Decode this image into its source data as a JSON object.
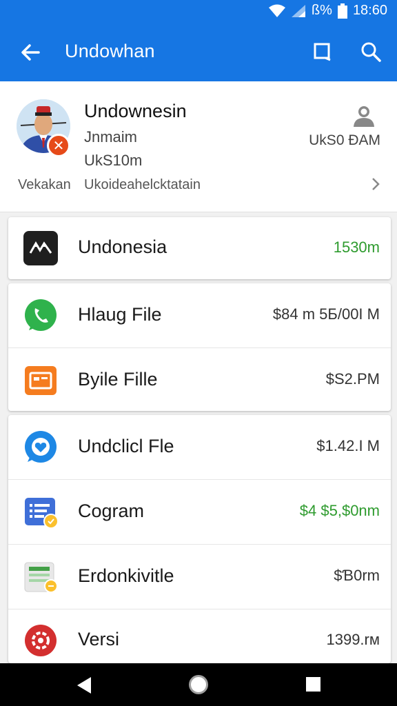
{
  "status_bar": {
    "battery_text": "ß%",
    "time": "18:60"
  },
  "app_bar": {
    "title": "Undowhan",
    "icons": [
      "back-arrow-icon",
      "crop-square-icon",
      "search-icon"
    ]
  },
  "profile": {
    "name": "Undownesin",
    "subtitle1": "Jnmaim",
    "subtitle2": "UkS10m",
    "time": "UkS0 ÐAM",
    "footer_left": "Vekakan",
    "footer_text": "Ukoideahelcktatain"
  },
  "groups": [
    {
      "items": [
        {
          "label": "Undonesia",
          "value": "1530m",
          "value_color": "#2e9b2e",
          "icon": "app-logo-icon"
        }
      ]
    },
    {
      "items": [
        {
          "label": "Hlaug File",
          "value": "$84 m 5Б/00I M",
          "icon": "chat-phone-icon"
        },
        {
          "label": "Byile Fille",
          "value": "$S2.PM",
          "icon": "briefcase-icon"
        }
      ]
    },
    {
      "items": [
        {
          "label": "Undclicl Fle",
          "value": "$1.42.I M",
          "icon": "messenger-icon"
        },
        {
          "label": "Cogram",
          "value": "$4 $5,$0nm",
          "value_color": "#2e9b2e",
          "icon": "list-app-icon"
        },
        {
          "label": "Erdonkivitle",
          "value": "$Ɓ0rm",
          "icon": "spreadsheet-icon"
        },
        {
          "label": "Versi",
          "value": "1399.rм",
          "icon": "red-gear-icon"
        }
      ]
    }
  ],
  "colors": {
    "primary": "#1676e3",
    "accent_green": "#2e9b2e"
  }
}
